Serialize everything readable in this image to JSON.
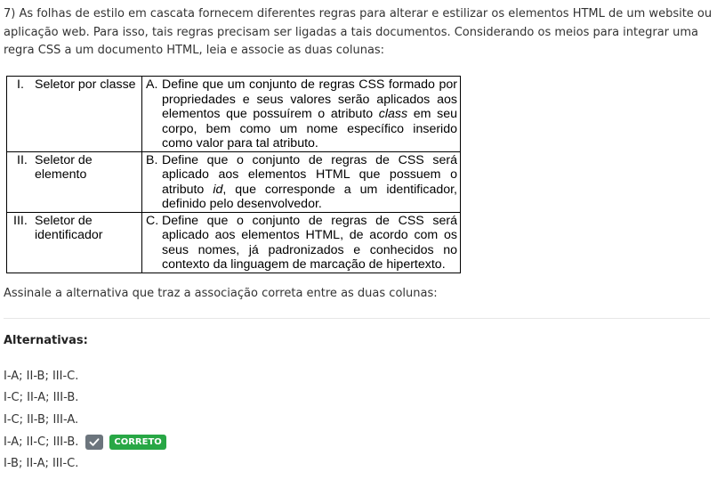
{
  "question": {
    "text": "7) As folhas de estilo em cascata fornecem diferentes regras para alterar e estilizar os elementos HTML de um website ou aplicação web. Para isso, tais regras precisam ser ligadas a tais documentos. Considerando os meios para integrar uma regra CSS a um documento HTML, leia e associe as duas colunas:"
  },
  "table": {
    "rows": [
      {
        "left_num": "I.",
        "left_text": "Seletor por classe",
        "right_num": "A.",
        "right_text": "Define que um conjunto de regras CSS formado por propriedades e seus valores serão aplicados aos elementos que possuírem o atributo class em seu corpo, bem como um nome específico inserido como valor para tal atributo."
      },
      {
        "left_num": "II.",
        "left_text": "Seletor de elemento",
        "right_num": "B.",
        "right_text": "Define que o conjunto de regras de CSS será aplicado aos elementos HTML que possuem o atributo id, que corresponde a um identificador, definido pelo desenvolvedor."
      },
      {
        "left_num": "III.",
        "left_text": "Seletor de identificador",
        "right_num": "C.",
        "right_text": "Define que o conjunto de regras de CSS será aplicado aos elementos HTML, de acordo com os seus nomes, já padronizados e conhecidos no contexto da linguagem de marcação de hipertexto."
      }
    ]
  },
  "instruction": "Assinale a alternativa que traz a associação correta entre as duas colunas:",
  "alternatives_title": "Alternativas:",
  "alternatives": [
    {
      "label": "I-A; II-B; III-C."
    },
    {
      "label": "I-C; II-A; III-B."
    },
    {
      "label": "I-C; II-B; III-A."
    },
    {
      "label": "I-A; II-C; III-B.",
      "badge": "CORRETO"
    },
    {
      "label": "I-B; II-A; III-C."
    }
  ],
  "colors": {
    "badge_green": "#28a745",
    "check_gray": "#6c757d"
  },
  "icons": {
    "check": "checkmark-icon"
  }
}
